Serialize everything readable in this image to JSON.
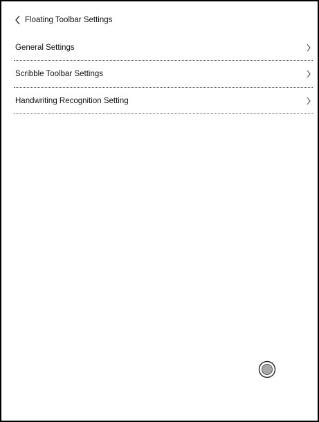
{
  "header": {
    "back_icon": "chevron-left-icon",
    "title": "Floating Toolbar Settings"
  },
  "settings": {
    "items": [
      {
        "label": "General Settings",
        "icon": "chevron-right-icon"
      },
      {
        "label": "Scribble Toolbar Settings",
        "icon": "chevron-right-icon"
      },
      {
        "label": "Handwriting Recognition Setting",
        "icon": "chevron-right-icon"
      }
    ]
  },
  "floating_ball": {
    "icon": "floating-ball-icon"
  }
}
